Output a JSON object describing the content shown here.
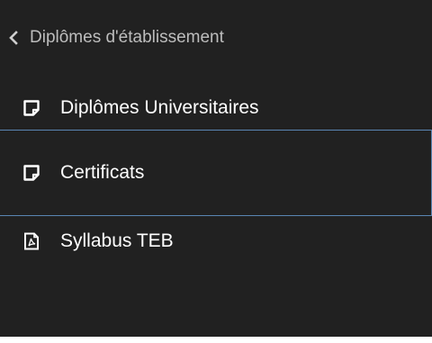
{
  "nav": {
    "back_label": "Diplômes d'établissement",
    "back_icon": "chevron-left-icon",
    "items": [
      {
        "label": "Diplômes Universitaires",
        "icon": "note-icon",
        "active": false
      },
      {
        "label": "Certificats",
        "icon": "note-icon",
        "active": true
      },
      {
        "label": "Syllabus TEB",
        "icon": "pdf-file-icon",
        "active": false
      }
    ]
  },
  "colors": {
    "panel_bg": "#212121",
    "text": "#ffffff",
    "muted_text": "#bdbdbd",
    "active_border": "#5a86b3"
  }
}
